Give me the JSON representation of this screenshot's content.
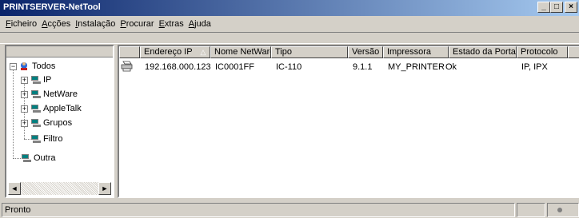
{
  "window": {
    "title": "PRINTSERVER-NetTool",
    "minimize": "_",
    "maximize": "□",
    "close": "×"
  },
  "menu": [
    {
      "label": "Ficheiro",
      "u": "F",
      "rest": "icheiro"
    },
    {
      "label": "Acções",
      "u": "A",
      "rest": "cções"
    },
    {
      "label": "Instalação",
      "u": "I",
      "rest": "nstalação"
    },
    {
      "label": "Procurar",
      "u": "P",
      "rest": "rocurar"
    },
    {
      "label": "Extras",
      "u": "E",
      "rest": "xtras"
    },
    {
      "label": "Ajuda",
      "u": "A",
      "rest": "juda"
    }
  ],
  "tree": {
    "root": "Todos",
    "children": [
      "IP",
      "NetWare",
      "AppleTalk",
      "Grupos",
      "Filtro"
    ],
    "other": "Outra",
    "expander_collapse": "−",
    "expander_expand": "+"
  },
  "table": {
    "headers": [
      "Endereço IP",
      "Nome NetWare",
      "Tipo",
      "Versão",
      "Impressora",
      "Estado da Porta",
      "Protocolo"
    ],
    "rows": [
      [
        "192.168.000.123",
        "IC0001FF",
        "IC-110",
        "9.1.1",
        "MY_PRINTER",
        "Ok",
        "IP, IPX"
      ]
    ]
  },
  "status": {
    "text": "Pronto"
  },
  "scroll": {
    "left": "◄",
    "right": "►"
  },
  "colors": {
    "titlebar_start": "#0a246a",
    "titlebar_end": "#a6caf0",
    "face": "#d4d0c8"
  }
}
